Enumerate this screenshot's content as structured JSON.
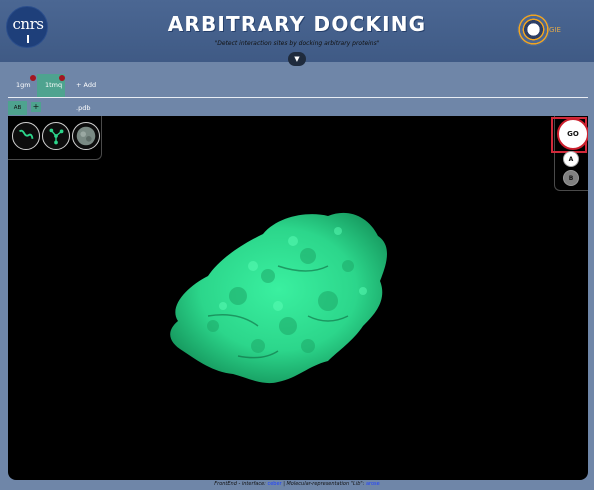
{
  "header": {
    "title": "ARBITRARY DOCKING",
    "subtitle": "\"Detect interaction sites by docking arbitrary proteins\"",
    "left_logo_text": "cnrs",
    "right_logo_text": "GIE",
    "collapse_icon": "chevron-down-icon"
  },
  "tabs": [
    {
      "label": "1gm",
      "active": false,
      "has_dot": true
    },
    {
      "label": "1tmq",
      "active": true,
      "has_dot": true
    }
  ],
  "add_pdb_label": "+ Add .pdb",
  "chain_tab": {
    "label": "AB"
  },
  "add_chain_label": "+",
  "viewer": {
    "representations": [
      "cartoon-icon",
      "ball-stick-icon",
      "surface-icon"
    ],
    "go_label": "GO",
    "partner_a": "A",
    "partner_b": "B",
    "surface_color": "#2cd68b"
  },
  "footer": {
    "prefix": "FrontEnd - interface:",
    "link1": "ceber",
    "middle": "| Molecular-representation \"Lib\":",
    "link2": "arose"
  }
}
